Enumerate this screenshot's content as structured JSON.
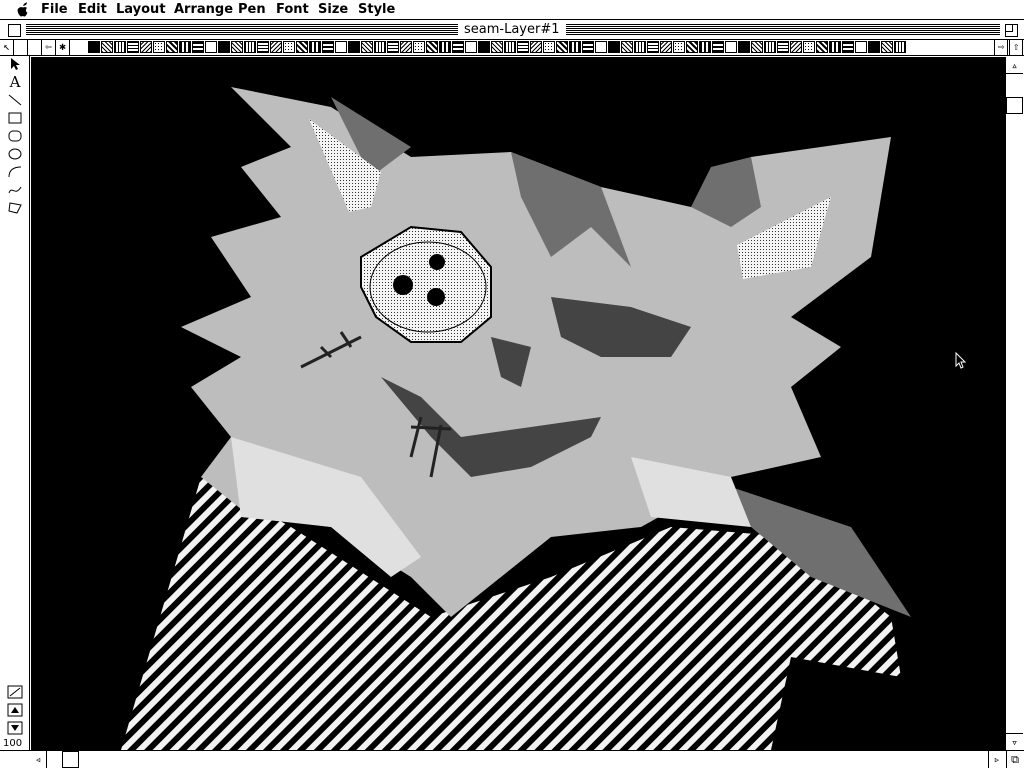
{
  "menubar": {
    "apple_icon": "apple-icon",
    "items": [
      "File",
      "Edit",
      "Layout",
      "Arrange",
      "Pen",
      "Font",
      "Size",
      "Style"
    ]
  },
  "window": {
    "title": "seam-Layer#1"
  },
  "palette": {
    "tools": [
      "arrow-tool",
      "text-tool",
      "line-tool",
      "rectangle-tool",
      "rounded-rectangle-tool",
      "oval-tool",
      "arc-tool",
      "freehand-tool",
      "polygon-tool"
    ],
    "text_tool_glyph": "A",
    "zoom_level": "100"
  },
  "colors": {
    "background": "#000000",
    "light": "#f0f0f0",
    "medium": "#bdbdbd",
    "dark": "#6f6f6f",
    "stripes": "#8a8a8a"
  }
}
